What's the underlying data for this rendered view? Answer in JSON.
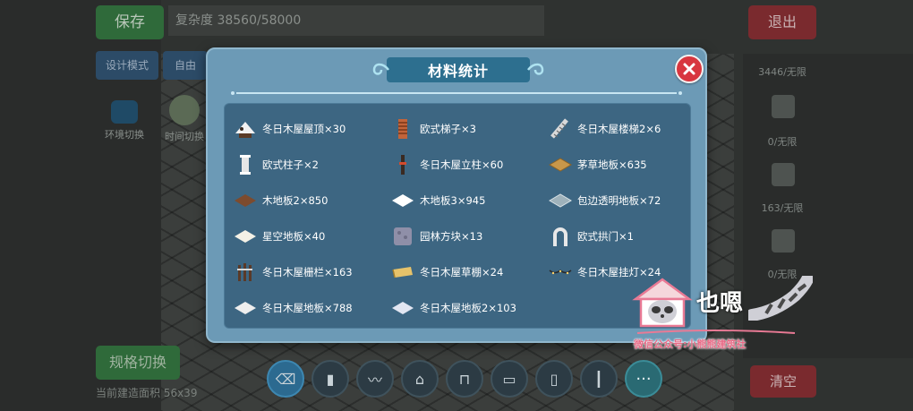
{
  "header": {
    "save_label": "保存",
    "complexity_text": "复杂度 38560/58000",
    "exit_label": "退出"
  },
  "mode_buttons": {
    "design_label": "设计模式",
    "freedom_label": "自由"
  },
  "left_tools": [
    {
      "icon": "water-icon",
      "label": "环境切换"
    },
    {
      "icon": "mountain-icon",
      "label": "时间切换"
    }
  ],
  "right_side": [
    {
      "count": "3446/无限"
    },
    {
      "count": "0/无限"
    },
    {
      "count": "163/无限"
    },
    {
      "count": "0/无限"
    }
  ],
  "bottom": {
    "specs_label": "规格切换",
    "specs_text": "当前建造面积 56x39",
    "clear_label": "清空"
  },
  "hotbar": [
    {
      "icon": "eraser-icon",
      "glyph": "⌫"
    },
    {
      "icon": "door-icon",
      "glyph": "▮"
    },
    {
      "icon": "lights-string-icon",
      "glyph": "〰"
    },
    {
      "icon": "roof-icon",
      "glyph": "⌂"
    },
    {
      "icon": "arch-window-icon",
      "glyph": "⊓"
    },
    {
      "icon": "thatch-icon",
      "glyph": "▭"
    },
    {
      "icon": "door-dark-icon",
      "glyph": "▯"
    },
    {
      "icon": "pillar-icon",
      "glyph": "┃"
    },
    {
      "icon": "more-icon",
      "glyph": "···"
    }
  ],
  "dialog": {
    "title": "材料统计",
    "items": [
      {
        "icon": "winter-roof-icon",
        "label": "冬日木屋屋顶×30"
      },
      {
        "icon": "euro-ladder-icon",
        "label": "欧式梯子×3"
      },
      {
        "icon": "winter-stairs-icon",
        "label": "冬日木屋楼梯2×6"
      },
      {
        "icon": "euro-pillar-icon",
        "label": "欧式柱子×2"
      },
      {
        "icon": "winter-post-icon",
        "label": "冬日木屋立柱×60"
      },
      {
        "icon": "thatch-floor-icon",
        "label": "茅草地板×635"
      },
      {
        "icon": "wood-floor-2-icon",
        "label": "木地板2×850"
      },
      {
        "icon": "wood-floor-3-icon",
        "label": "木地板3×945"
      },
      {
        "icon": "glass-floor-icon",
        "label": "包边透明地板×72"
      },
      {
        "icon": "starry-floor-icon",
        "label": "星空地板×40"
      },
      {
        "icon": "garden-block-icon",
        "label": "园林方块×13"
      },
      {
        "icon": "euro-arch-icon",
        "label": "欧式拱门×1"
      },
      {
        "icon": "winter-fence-icon",
        "label": "冬日木屋栅栏×163"
      },
      {
        "icon": "winter-awning-icon",
        "label": "冬日木屋草棚×24"
      },
      {
        "icon": "winter-lights-icon",
        "label": "冬日木屋挂灯×24"
      },
      {
        "icon": "winter-floor-icon",
        "label": "冬日木屋地板×788"
      },
      {
        "icon": "winter-floor-2-icon",
        "label": "冬日木屋地板2×103"
      }
    ]
  },
  "watermark": {
    "name": "也嗯",
    "caption": "微信公众号:小熊熊建筑社"
  },
  "colors": {
    "dialog_bg": "#6c9ab6",
    "inner_panel": "#3d6682",
    "title_bg": "#2d6f8f",
    "close_red": "#d8363f"
  }
}
